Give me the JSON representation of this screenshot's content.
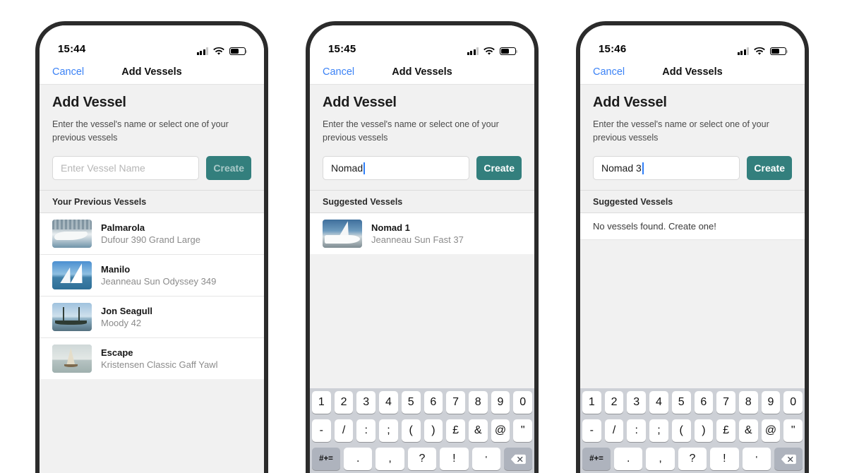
{
  "phones": [
    {
      "id": "phone-1",
      "status": {
        "time": "15:44",
        "cellular": "signal-bars-icon",
        "wifi": "wifi-icon",
        "battery": "battery-icon"
      },
      "nav": {
        "cancel": "Cancel",
        "title": "Add Vessels"
      },
      "form": {
        "heading": "Add Vessel",
        "subtitle": "Enter the vessel's name or select one of your previous vessels",
        "input_value": "",
        "input_placeholder": "Enter Vessel Name",
        "create_label": "Create",
        "create_enabled": false
      },
      "section_header": "Your Previous Vessels",
      "empty_message": "",
      "vessels": [
        {
          "name": "Palmarola",
          "model": "Dufour 390 Grand Large",
          "thumb": "t1"
        },
        {
          "name": "Manilo",
          "model": "Jeanneau Sun Odyssey 349",
          "thumb": "t2"
        },
        {
          "name": "Jon Seagull",
          "model": "Moody 42",
          "thumb": "t3"
        },
        {
          "name": "Escape",
          "model": "Kristensen Classic Gaff Yawl",
          "thumb": "t4"
        }
      ],
      "keyboard_visible": false
    },
    {
      "id": "phone-2",
      "status": {
        "time": "15:45",
        "cellular": "signal-bars-icon",
        "wifi": "wifi-icon",
        "battery": "battery-icon"
      },
      "nav": {
        "cancel": "Cancel",
        "title": "Add Vessels"
      },
      "form": {
        "heading": "Add Vessel",
        "subtitle": "Enter the vessel's name or select one of your previous vessels",
        "input_value": "Nomad",
        "input_placeholder": "Enter Vessel Name",
        "create_label": "Create",
        "create_enabled": true
      },
      "section_header": "Suggested Vessels",
      "empty_message": "",
      "vessels": [
        {
          "name": "Nomad 1",
          "model": "Jeanneau Sun Fast 37",
          "thumb": "t5"
        }
      ],
      "keyboard_visible": true
    },
    {
      "id": "phone-3",
      "status": {
        "time": "15:46",
        "cellular": "signal-bars-icon",
        "wifi": "wifi-icon",
        "battery": "battery-icon"
      },
      "nav": {
        "cancel": "Cancel",
        "title": "Add Vessels"
      },
      "form": {
        "heading": "Add Vessel",
        "subtitle": "Enter the vessel's name or select one of your previous vessels",
        "input_value": "Nomad 3",
        "input_placeholder": "Enter Vessel Name",
        "create_label": "Create",
        "create_enabled": true
      },
      "section_header": "Suggested Vessels",
      "empty_message": "No vessels found. Create one!",
      "vessels": [],
      "keyboard_visible": true
    }
  ],
  "keyboard": {
    "row1": [
      "1",
      "2",
      "3",
      "4",
      "5",
      "6",
      "7",
      "8",
      "9",
      "0"
    ],
    "row2": [
      "-",
      "/",
      ":",
      ";",
      "(",
      ")",
      "£",
      "&",
      "@",
      "\""
    ],
    "row3": [
      "#+=",
      ".",
      ",",
      "?",
      "!",
      "'",
      "delete-icon"
    ]
  },
  "colors": {
    "accent_teal": "#337f7d",
    "link_blue": "#3b82f6",
    "page_bg": "#f1f1f1",
    "frame": "#2b2b2b",
    "keyboard_bg": "#cdd0d6"
  }
}
